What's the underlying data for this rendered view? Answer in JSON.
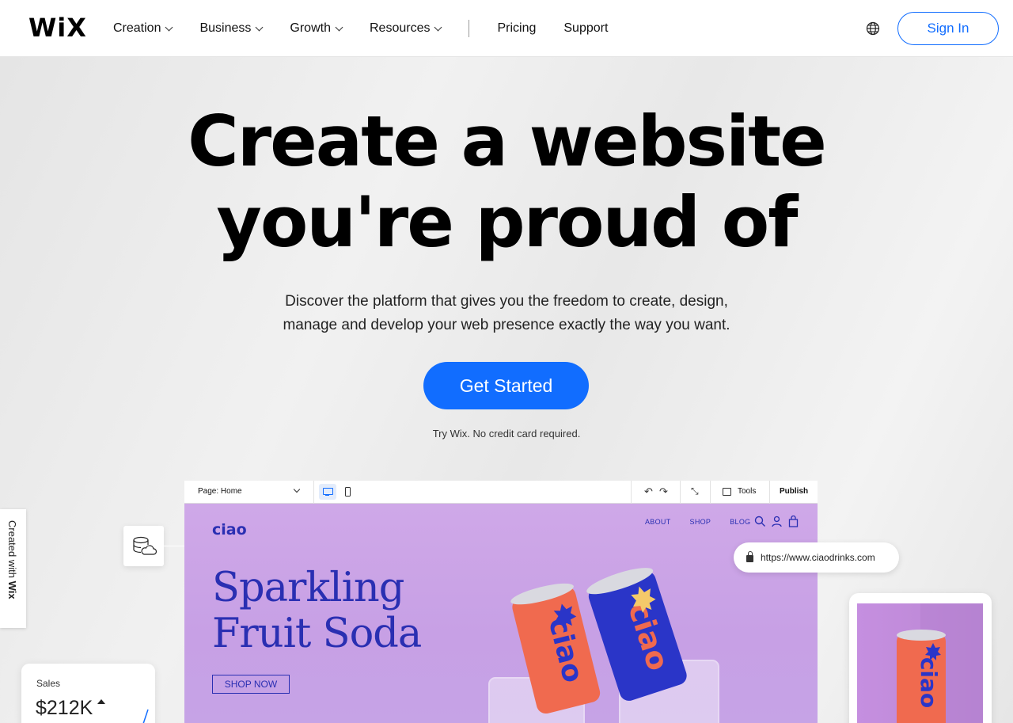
{
  "header": {
    "logo": "WiX",
    "nav": [
      {
        "label": "Creation",
        "dropdown": true
      },
      {
        "label": "Business",
        "dropdown": true
      },
      {
        "label": "Growth",
        "dropdown": true
      },
      {
        "label": "Resources",
        "dropdown": true
      }
    ],
    "links": [
      "Pricing",
      "Support"
    ],
    "globe_icon": "globe-icon",
    "sign_in": "Sign In"
  },
  "hero": {
    "title_line1": "Create a website",
    "title_line2": "you're proud of",
    "subtitle_line1": "Discover the platform that gives you the freedom to create, design,",
    "subtitle_line2": "manage and develop your web presence exactly the way you want.",
    "cta": "Get Started",
    "cta_note": "Try Wix. No credit card required."
  },
  "editor": {
    "page_selector": "Page: Home",
    "tools": "Tools",
    "publish": "Publish",
    "undo_icon": "↶",
    "redo_icon": "↷",
    "zoom_icon": "⤡"
  },
  "site_preview": {
    "logo": "ciao",
    "nav": [
      "ABOUT",
      "SHOP",
      "BLOG"
    ],
    "headline_line1": "Sparkling",
    "headline_line2": "Fruit Soda",
    "shop_button": "SHOP NOW",
    "url": "https://www.ciaodrinks.com"
  },
  "side_tab": {
    "prefix": "Created with ",
    "brand": "Wix"
  },
  "sales_card": {
    "label": "Sales",
    "value": "$212K"
  },
  "colors": {
    "accent": "#116dff",
    "site_bg": "#c9a3e6",
    "site_text": "#2a2fb2",
    "can_orange": "#f06a4f",
    "can_blue": "#2a35c8"
  }
}
